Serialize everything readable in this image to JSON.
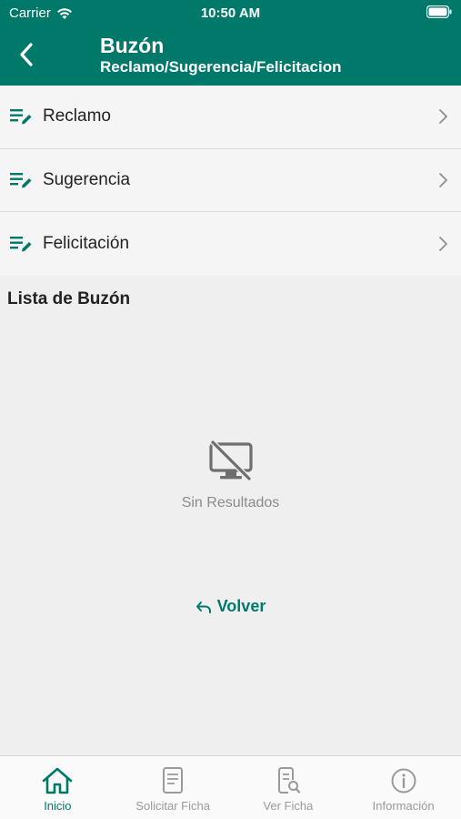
{
  "status_bar": {
    "carrier": "Carrier",
    "time": "10:50 AM"
  },
  "header": {
    "title": "Buzón",
    "subtitle": "Reclamo/Sugerencia/Felicitacion"
  },
  "menu": {
    "items": [
      {
        "label": "Reclamo",
        "icon": "edit-list-icon"
      },
      {
        "label": "Sugerencia",
        "icon": "edit-list-icon"
      },
      {
        "label": "Felicitación",
        "icon": "edit-list-icon"
      }
    ]
  },
  "list": {
    "title": "Lista de Buzón",
    "empty_text": "Sin Resultados"
  },
  "actions": {
    "volver_label": "Volver"
  },
  "tabbar": {
    "tabs": [
      {
        "label": "Inicio",
        "icon": "home-icon",
        "active": true
      },
      {
        "label": "Solicitar Ficha",
        "icon": "document-icon",
        "active": false
      },
      {
        "label": "Ver Ficha",
        "icon": "document-search-icon",
        "active": false
      },
      {
        "label": "Información",
        "icon": "info-icon",
        "active": false
      }
    ]
  },
  "colors": {
    "primary": "#00796b",
    "background": "#efefef",
    "menu_bg": "#f5f5f5",
    "muted": "#8a8a8a"
  }
}
